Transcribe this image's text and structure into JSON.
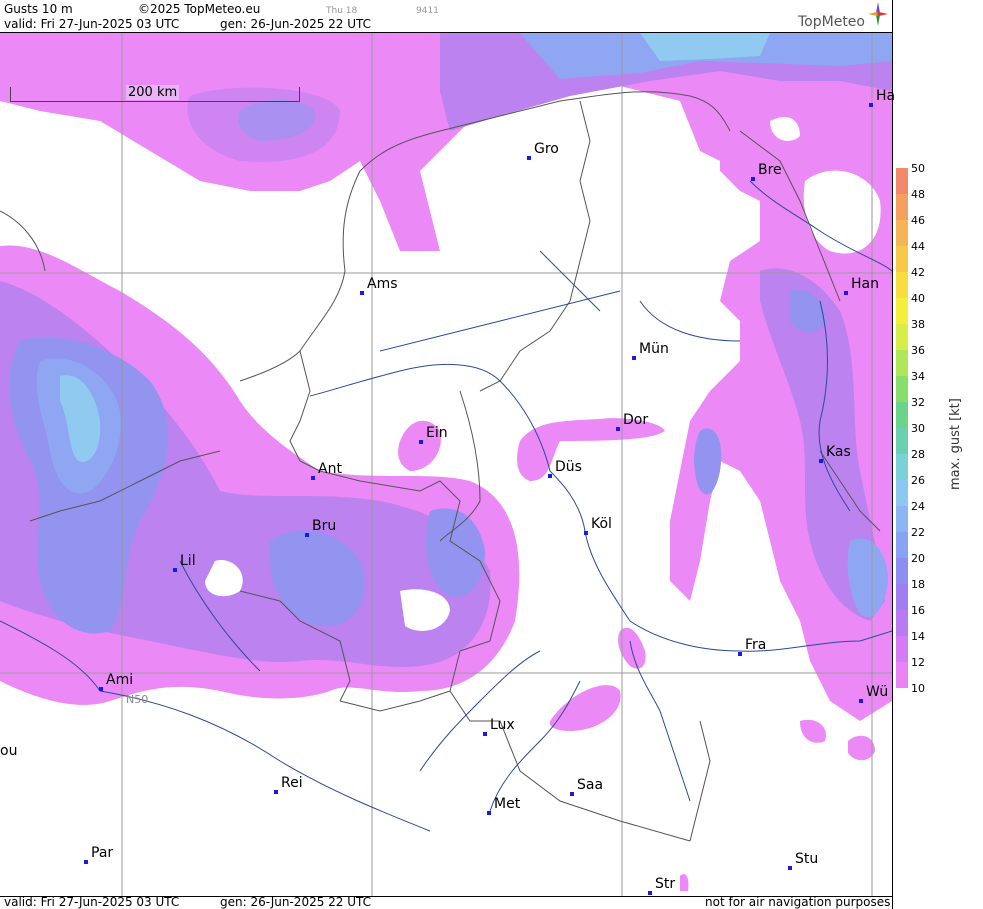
{
  "header": {
    "product": "Gusts 10 m",
    "copyright": "©2025 TopMeteo.eu",
    "run_label": "Thu 18",
    "code": "9411",
    "valid": "valid:  Fri  27-Jun-2025  03 UTC",
    "gen": "gen: 26-Jun-2025 22 UTC"
  },
  "logo": {
    "text": "TopMeteo",
    "icon": "compass-star-icon"
  },
  "map": {
    "scale_label": "200 km",
    "graticule_label": "N50",
    "cities": [
      "Ha",
      "Gro",
      "Bre",
      "Ams",
      "Han",
      "Mün",
      "Dor",
      "Ein",
      "Ant",
      "Düs",
      "Kas",
      "Bru",
      "Köl",
      "Lil",
      "Fra",
      "Ami",
      "Wü",
      "Lux",
      "ou",
      "Rei",
      "Saa",
      "Met",
      "Par",
      "Stu",
      "Str"
    ]
  },
  "footer": {
    "valid": "valid:  Fri  27-Jun-2025  03 UTC",
    "gen": "gen: 26-Jun-2025 22 UTC",
    "notice": "not for air navigation purposes"
  },
  "legend": {
    "title": "max. gust [kt]",
    "ticks": [
      "50",
      "48",
      "46",
      "44",
      "42",
      "40",
      "38",
      "36",
      "34",
      "32",
      "30",
      "28",
      "26",
      "24",
      "22",
      "20",
      "18",
      "16",
      "14",
      "12",
      "10"
    ],
    "colors": [
      "#f08a6a",
      "#f3a060",
      "#f5b455",
      "#f7c84a",
      "#f9dc40",
      "#f5ef3c",
      "#d8ee48",
      "#b0e65a",
      "#88de6c",
      "#6cd48a",
      "#6cd0b0",
      "#7cd0d8",
      "#8cc8f0",
      "#8cb6f2",
      "#8aa2f2",
      "#8e8ef0",
      "#a07ef2",
      "#b87cf0",
      "#d67cf2",
      "#ea84f6"
    ]
  },
  "colors": {
    "gust_low": "#ea84f6",
    "gust_mid": "#b87cf0",
    "gust_high": "#8e8ef0",
    "gust_light_blue": "#8cc8f0",
    "city_marker": "#1a1ae6"
  }
}
